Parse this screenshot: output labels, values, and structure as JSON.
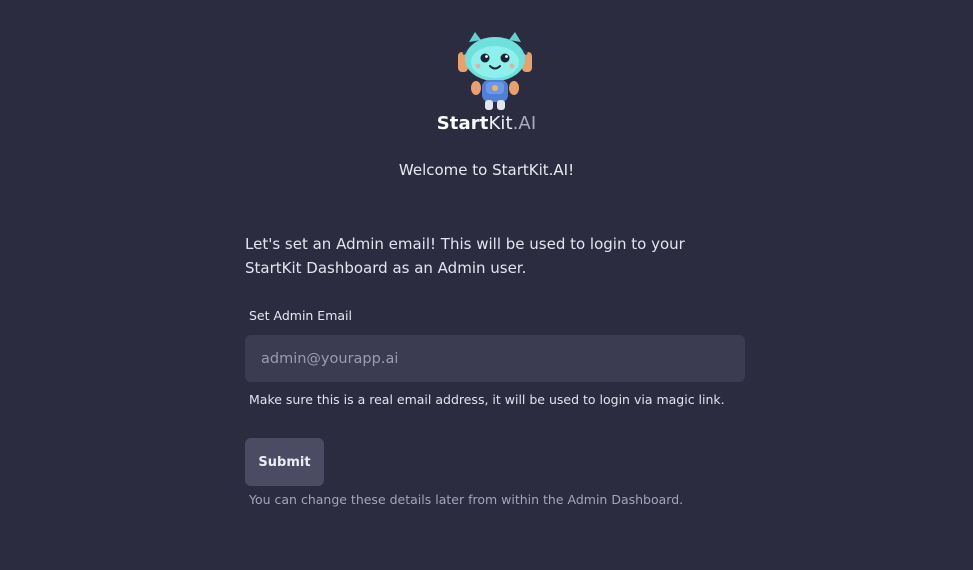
{
  "brand": {
    "logo_icon": "robot-mascot-icon",
    "name_part1": "Start",
    "name_part2": "Kit",
    "name_part3": ".AI"
  },
  "welcome_text": "Welcome to StartKit.AI!",
  "intro_text": "Let's set an Admin email! This will be used to login to your StartKit Dashboard as an Admin user.",
  "form": {
    "email_label": "Set Admin Email",
    "email_placeholder": "admin@yourapp.ai",
    "email_value": "",
    "hint": "Make sure this is a real email address, it will be used to login via magic link.",
    "submit_label": "Submit",
    "footnote": "You can change these details later from within the Admin Dashboard."
  },
  "colors": {
    "background": "#2b2c40",
    "input_background": "#3b3c51",
    "button_background": "#4b4c63"
  }
}
